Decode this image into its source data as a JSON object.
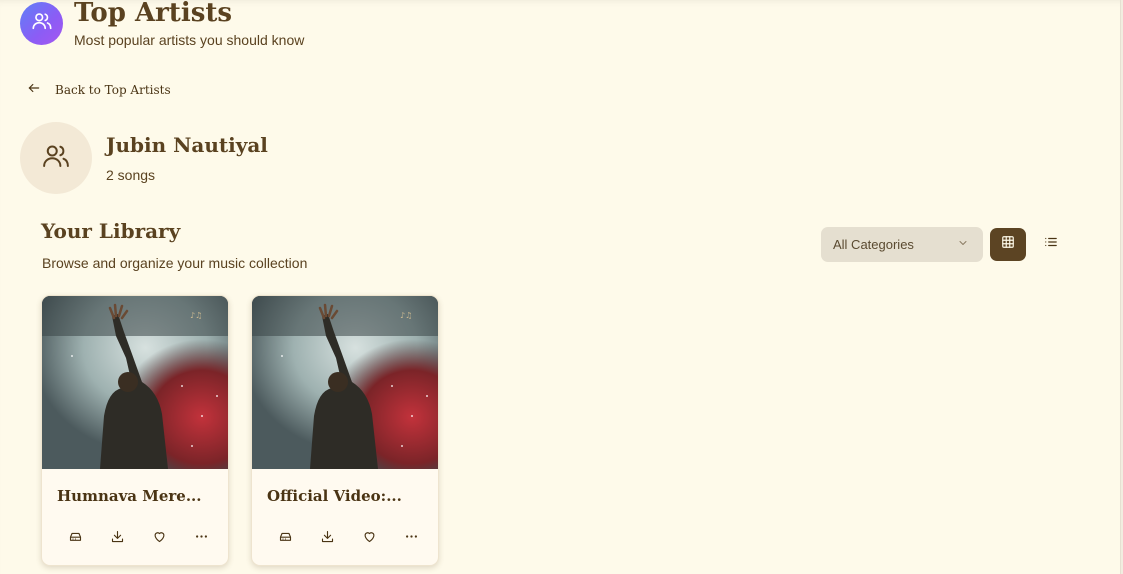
{
  "header": {
    "title": "Top Artists",
    "subtitle": "Most popular artists you should know",
    "icon": "users-icon"
  },
  "nav": {
    "back_label": "Back to Top Artists",
    "back_icon": "arrow-left-icon"
  },
  "artist": {
    "name": "Jubin Nautiyal",
    "song_count": "2 songs",
    "icon": "users-icon"
  },
  "library": {
    "title": "Your Library",
    "subtitle": "Browse and organize your music collection",
    "category_selected": "All Categories",
    "view_mode": "grid"
  },
  "songs": [
    {
      "title": "Humnava Mere...",
      "actions": [
        "playlist-icon",
        "download-icon",
        "heart-icon",
        "more-icon"
      ]
    },
    {
      "title": "Official Video:...",
      "actions": [
        "playlist-icon",
        "download-icon",
        "heart-icon",
        "more-icon"
      ]
    }
  ],
  "colors": {
    "background": "#fefaea",
    "text": "#5a4220",
    "accent": "#5c4423",
    "avatar_gradient_start": "#5f80f7",
    "avatar_gradient_end": "#a557f0"
  }
}
